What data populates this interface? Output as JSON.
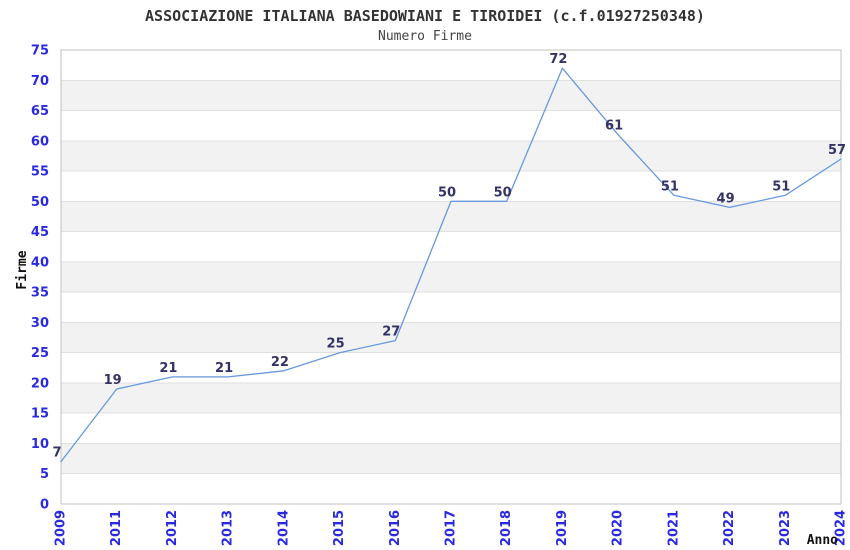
{
  "chart_data": {
    "type": "line",
    "title": "ASSOCIAZIONE ITALIANA BASEDOWIANI E TIROIDEI (c.f.01927250348)",
    "subtitle": "Numero Firme",
    "xlabel": "Anno",
    "ylabel": "Firme",
    "categories": [
      "2009",
      "2011",
      "2012",
      "2013",
      "2014",
      "2015",
      "2016",
      "2017",
      "2018",
      "2019",
      "2020",
      "2021",
      "2022",
      "2023",
      "2024"
    ],
    "values": [
      7,
      19,
      21,
      21,
      22,
      25,
      27,
      50,
      50,
      72,
      61,
      51,
      49,
      51,
      57
    ],
    "yticks": [
      0,
      5,
      10,
      15,
      20,
      25,
      30,
      35,
      40,
      45,
      50,
      55,
      60,
      65,
      70,
      75
    ],
    "ylim": [
      0,
      75
    ],
    "ytick_step": 5,
    "grid": "horizontal alternating bands",
    "legend": "none",
    "x_tick_rotation": -90,
    "colors": {
      "line": "#6699dd",
      "data_label": "#333366",
      "tick_label": "#2929e0",
      "band_alt": "#f2f2f2",
      "band_main": "#ffffff",
      "gridline": "#e0e0e0",
      "plot_border": "#c0c0c0",
      "title": "#333333",
      "subtitle": "#444444",
      "axis_title": "#111111"
    }
  }
}
